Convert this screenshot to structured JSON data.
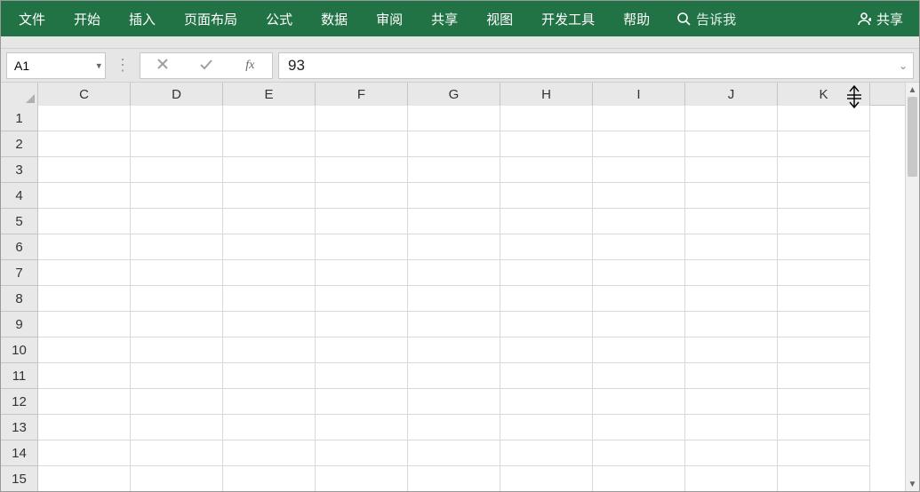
{
  "ribbon": {
    "tabs": [
      "文件",
      "开始",
      "插入",
      "页面布局",
      "公式",
      "数据",
      "审阅",
      "共享",
      "视图",
      "开发工具",
      "帮助"
    ],
    "tellme": "告诉我",
    "share": "共享"
  },
  "formula_bar": {
    "name_box": "A1",
    "fx_label": "fx",
    "value": "93"
  },
  "grid": {
    "columns": [
      "C",
      "D",
      "E",
      "F",
      "G",
      "H",
      "I",
      "J",
      "K"
    ],
    "rows": [
      "1",
      "2",
      "3",
      "4",
      "5",
      "6",
      "7",
      "8",
      "9",
      "10",
      "11",
      "12",
      "13",
      "14",
      "15"
    ]
  }
}
